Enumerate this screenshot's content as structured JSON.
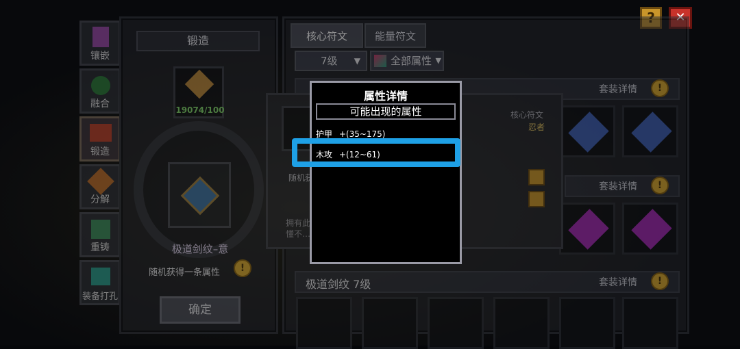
{
  "top_controls": {
    "help_label": "?",
    "close_label": "✕"
  },
  "left_panel": {
    "title": "锻造",
    "progress_text": "19074/100",
    "item_name": "极道剑纹–意",
    "random_attr": "随机获得一条属性",
    "confirm_label": "确定"
  },
  "side_menu": [
    {
      "label": "镶嵌"
    },
    {
      "label": "融合"
    },
    {
      "label": "锻造"
    },
    {
      "label": "分解"
    },
    {
      "label": "重铸"
    },
    {
      "label": "装备打孔"
    }
  ],
  "right_panel": {
    "tabs": [
      {
        "label": "核心符文"
      },
      {
        "label": "能量符文"
      }
    ],
    "level_select": "7级",
    "filter_select": "全部属性",
    "set_details_label": "套装详情",
    "section3_title": "极道剑纹 7级"
  },
  "middle_panel": {
    "category_label": "核心符文",
    "class_label": "忍者",
    "random_attr": "随机获得一条属性",
    "desc_line1": "拥有此…",
    "desc_line2": "懂不…"
  },
  "popup": {
    "title": "属性详情",
    "subtitle": "可能出现的属性",
    "attrs": [
      {
        "name": "护甲",
        "value": "+(35~175)"
      },
      {
        "name": "木攻",
        "value": "+(12~61)"
      }
    ]
  },
  "colors": {
    "highlight": "#1ea0e6",
    "accent_gold": "#d7a730",
    "close_red": "#c8322a"
  }
}
